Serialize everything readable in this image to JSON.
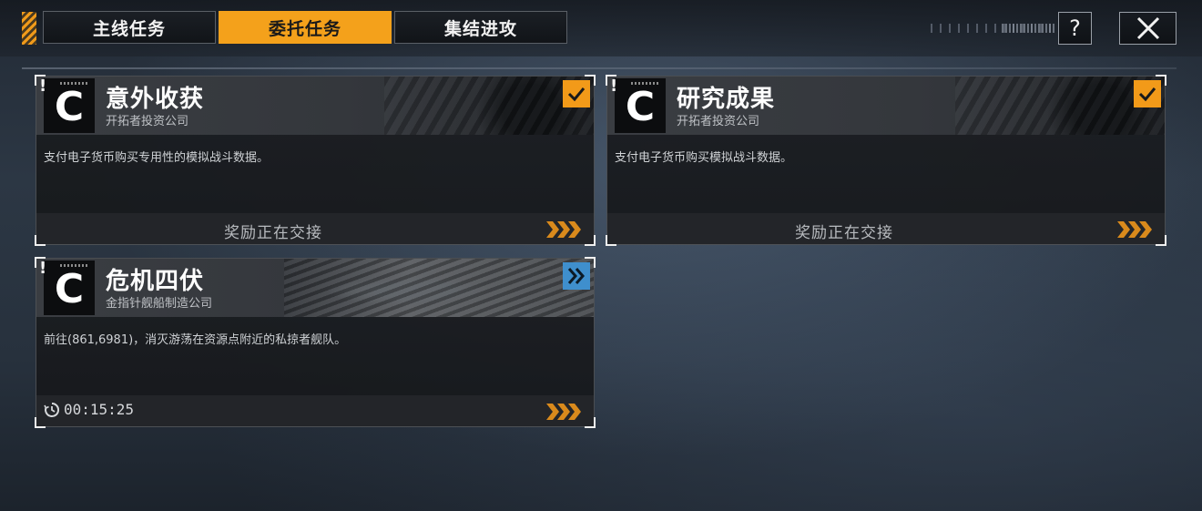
{
  "tabs": [
    {
      "label": "主线任务",
      "active": false
    },
    {
      "label": "委托任务",
      "active": true
    },
    {
      "label": "集结进攻",
      "active": false
    }
  ],
  "toolbar": {
    "help_label": "?",
    "close_label": "✕"
  },
  "colors": {
    "accent": "#f4a11b",
    "go_blue": "#3f8fcd"
  },
  "missions": [
    {
      "rank": "C",
      "excl": "!",
      "title": "意外收获",
      "company": "开拓者投资公司",
      "description": "支付电子货币购买专用性的模拟战斗数据。",
      "status_icon": "checkmark-icon",
      "footer": "奖励正在交接"
    },
    {
      "rank": "C",
      "excl": "!",
      "title": "研究成果",
      "company": "开拓者投资公司",
      "description": "支付电子货币购买模拟战斗数据。",
      "status_icon": "checkmark-icon",
      "footer": "奖励正在交接"
    },
    {
      "rank": "C",
      "excl": "!",
      "title": "危机四伏",
      "company": "金指针舰船制造公司",
      "description": "前往(861,6981)，消灭游荡在资源点附近的私掠者舰队。",
      "status_icon": "double-chevron-icon",
      "timer": "00:15:25"
    }
  ]
}
